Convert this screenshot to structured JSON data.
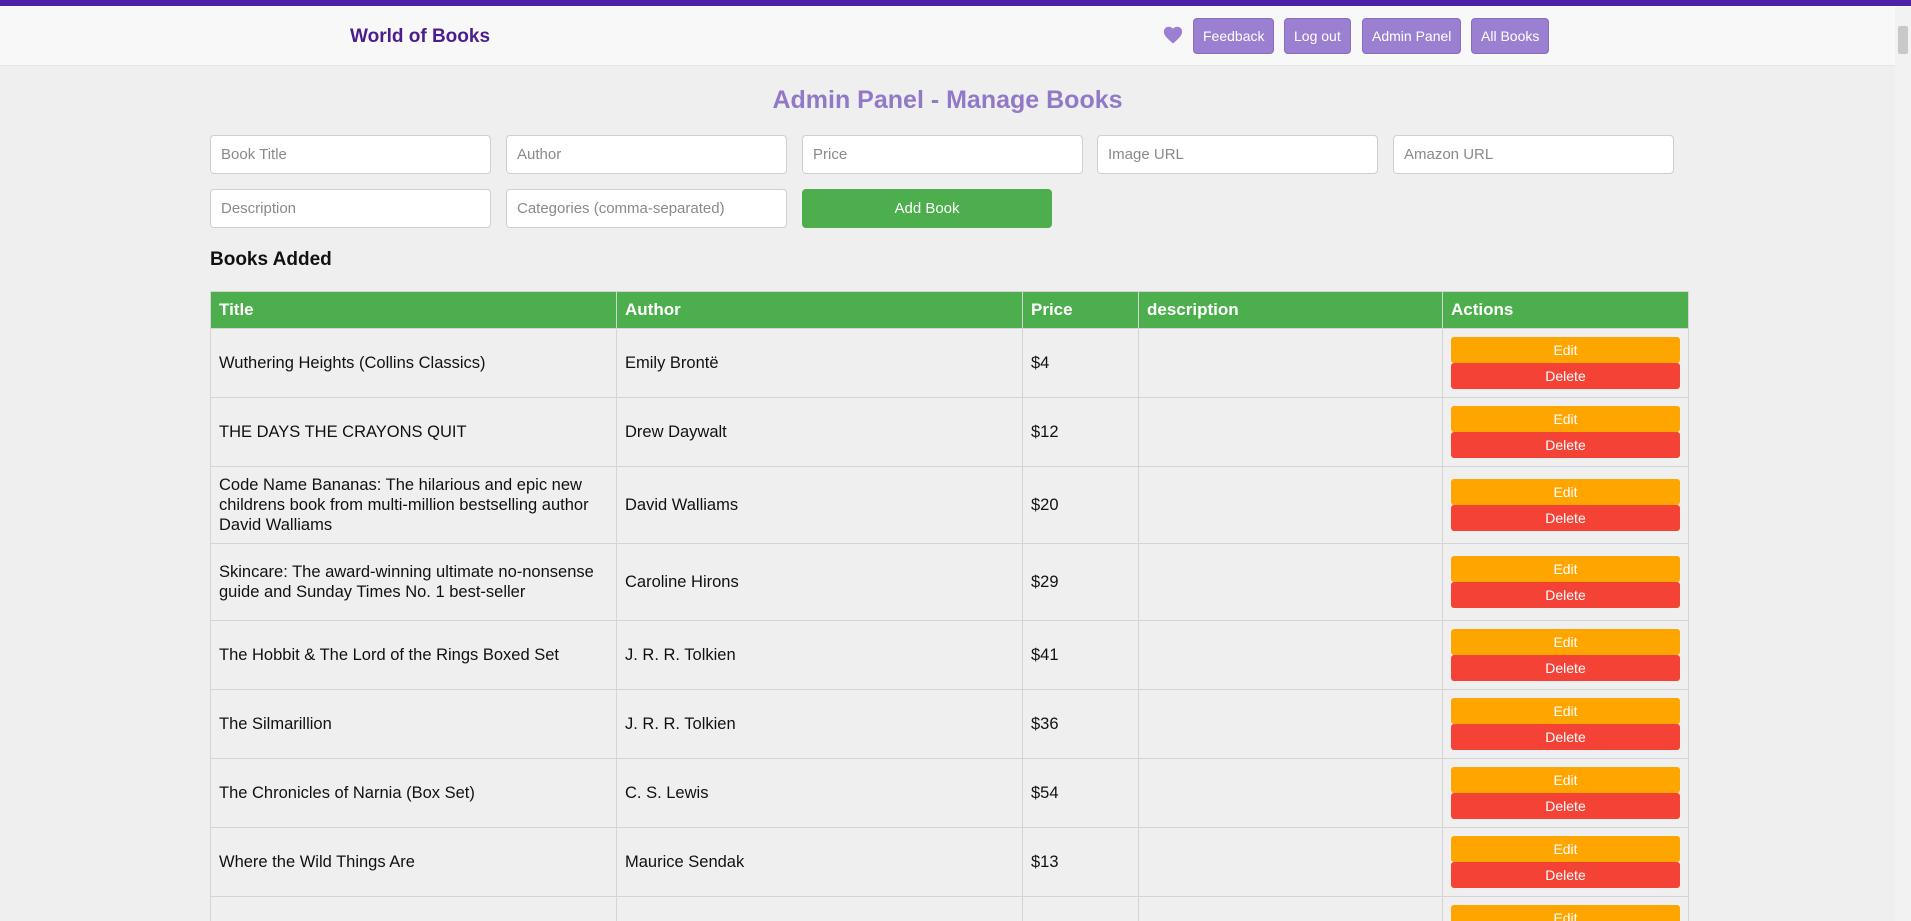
{
  "brand": "World of Books",
  "colors": {
    "accent": "#9b7fd0",
    "brand": "#4b1d8c",
    "table_header": "#4cae4c",
    "edit": "#ffa500",
    "delete": "#f44336"
  },
  "nav": {
    "favorites_icon": "heart-icon",
    "feedback": "Feedback",
    "logout": "Log out",
    "admin_panel": "Admin Panel",
    "all_books": "All Books"
  },
  "page_title": "Admin Panel - Manage Books",
  "form": {
    "title_placeholder": "Book Title",
    "author_placeholder": "Author",
    "price_placeholder": "Price",
    "image_placeholder": "Image URL",
    "amazon_placeholder": "Amazon URL",
    "description_placeholder": "Description",
    "categories_placeholder": "Categories (comma-separated)",
    "add_label": "Add Book"
  },
  "books_section_title": "Books Added",
  "table": {
    "headers": {
      "title": "Title",
      "author": "Author",
      "price": "Price",
      "description": "description",
      "actions": "Actions"
    },
    "edit_label": "Edit",
    "delete_label": "Delete",
    "rows": [
      {
        "title": "Wuthering Heights (Collins Classics)",
        "author": "Emily Brontë",
        "price": "$4",
        "description": ""
      },
      {
        "title": "THE DAYS THE CRAYONS QUIT",
        "author": "Drew Daywalt",
        "price": "$12",
        "description": ""
      },
      {
        "title": "Code Name Bananas: The hilarious and epic new childrens book from multi-million bestselling author David Walliams",
        "author": "David Walliams",
        "price": "$20",
        "description": ""
      },
      {
        "title": "Skincare: The award-winning ultimate no-nonsense guide and Sunday Times No. 1 best-seller",
        "author": "Caroline Hirons",
        "price": "$29",
        "description": ""
      },
      {
        "title": "The Hobbit & The Lord of the Rings Boxed Set",
        "author": "J. R. R. Tolkien",
        "price": "$41",
        "description": ""
      },
      {
        "title": "The Silmarillion",
        "author": "J. R. R. Tolkien",
        "price": "$36",
        "description": ""
      },
      {
        "title": "The Chronicles of Narnia (Box Set)",
        "author": "C. S. Lewis",
        "price": "$54",
        "description": ""
      },
      {
        "title": "Where the Wild Things Are",
        "author": "Maurice Sendak",
        "price": "$13",
        "description": ""
      },
      {
        "title": "",
        "author": "",
        "price": "",
        "description": ""
      }
    ]
  }
}
